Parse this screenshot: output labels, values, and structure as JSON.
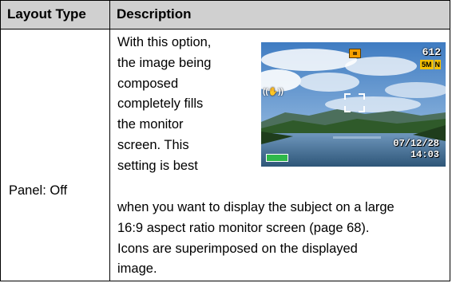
{
  "table": {
    "headers": [
      "Layout Type",
      "Description"
    ],
    "row": {
      "layout_type": "Panel: Off",
      "description_lines_top": [
        "With this option,",
        "the image being",
        "composed",
        "completely fills",
        "the monitor",
        "screen. This",
        "setting is best"
      ],
      "description_lines_bottom": [
        "when you want to display the subject on a large",
        "16:9 aspect ratio monitor screen (page 68).",
        "Icons are superimposed on the displayed",
        "image."
      ]
    }
  },
  "monitor_screen": {
    "shot_count": "612",
    "image_size": "5M",
    "quality": "N",
    "date": "07/12/28",
    "time": "14:03",
    "icons": [
      "recording-mode-icon",
      "anti-shake-hand-icon",
      "focus-frame-icon",
      "battery-level-icon"
    ],
    "colors": {
      "sky": "#6f9fd0",
      "water": "#3f6f98",
      "hills": "#2f5a2a",
      "battery": "#2fb84a",
      "badge": "#f5c000"
    }
  }
}
